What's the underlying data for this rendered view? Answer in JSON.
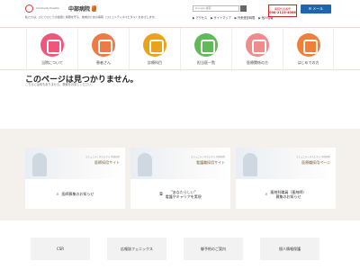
{
  "header": {
    "logo_sub": "Community Hospital",
    "logo_name": "中部病院",
    "tagline": "私たちは、ひとりひとりの健康と笑顔を守る、地域のための病院（コミュニティホスピタル）をめざします。",
    "search_placeholder": "Google 検索",
    "links": [
      "▶ アクセス",
      "▶ サイトマップ",
      "▶ 外来受診時間",
      "▶ 個人情報"
    ],
    "tel_label": "病院代表番号",
    "tel_number": "098-2123-4066",
    "mail_label": "✉ メール",
    "accent": "#1e64b4"
  },
  "nav": {
    "items": [
      {
        "label": "当院について",
        "icon": "hospital-icon",
        "color": "#f0567a"
      },
      {
        "label": "患者さん",
        "icon": "stethoscope-icon",
        "color": "#ee7a46"
      },
      {
        "label": "診療科目",
        "icon": "hand-icon",
        "color": "#e8a21c"
      },
      {
        "label": "担当医一覧",
        "icon": "doctor-icon",
        "color": "#62b95a"
      },
      {
        "label": "医療関係の方",
        "icon": "glasses-icon",
        "color": "#f08c8c"
      },
      {
        "label": "はじめての方",
        "icon": "calendar-icon",
        "color": "#f07f39"
      }
    ]
  },
  "main": {
    "title": "このページは見つかりません。",
    "description": "こちらには何もありません。検索をお試しください。"
  },
  "recruit": {
    "cards": [
      {
        "banner_sub": "コミュニティホスピタル 中部病院",
        "banner": "医師採用サイト",
        "text": "医師募集のお知らせ",
        "icon": "magnifier-icon"
      },
      {
        "banner_sub": "コミュニティホスピタル 中部病院",
        "banner": "看護職採用サイト",
        "text": "\"あなたらしい\"\n看護やキャリアを実現",
        "icon": "expand-icon"
      },
      {
        "banner_sub": "コミュニティホスピタル 中部病院",
        "banner": "医療職採用ページ",
        "text": "薬剤科職員（薬剤師）\n募集のお知らせ",
        "icon": "magnifier-icon"
      }
    ]
  },
  "footer": {
    "links": [
      "CSR",
      "広報誌フェニックス",
      "御予約のご案内",
      "個人情報保護"
    ]
  }
}
